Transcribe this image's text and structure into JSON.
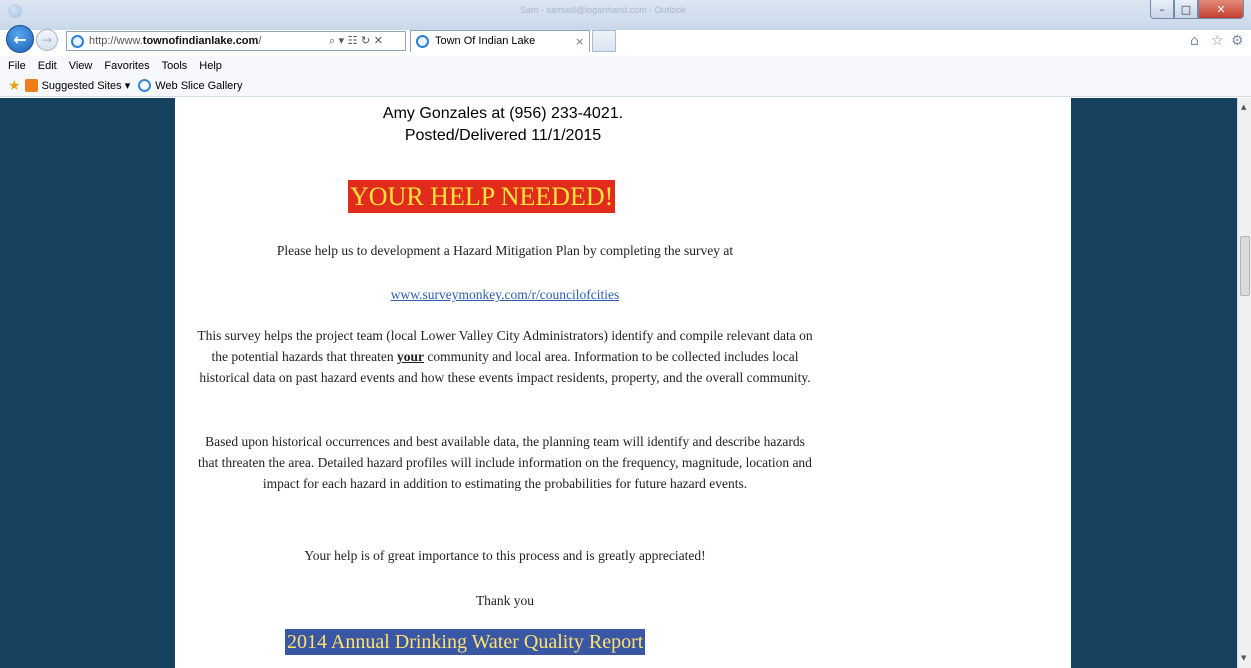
{
  "browser": {
    "window_title": "Sam - samwill@loganhand.com - Outlook",
    "address_prefix": "http://www.",
    "address_domain": "townofindianlake.com",
    "address_suffix": "/",
    "address_controls": "⌕ ▾ ☷ ↻ ✕",
    "tab_title": "Town Of Indian Lake",
    "tab_close": "×",
    "menu": [
      "File",
      "Edit",
      "View",
      "Favorites",
      "Tools",
      "Help"
    ],
    "favorites": {
      "suggested_sites": "Suggested Sites ▾",
      "web_slice_gallery": "Web Slice Gallery"
    },
    "icons": [
      "back-arrow",
      "forward-arrow",
      "ie-logo",
      "home",
      "star",
      "gear"
    ]
  },
  "page": {
    "contact_line": "Amy Gonzales at (956) 233-4021.",
    "posted_line": "Posted/Delivered 11/1/2015",
    "help_banner": "YOUR HELP NEEDED!",
    "intro_line": "Please help us to development a Hazard Mitigation Plan by completing the survey at",
    "survey_link": "www.surveymonkey.com/r/councilofcities",
    "para1_a": "This survey helps the project team (local Lower Valley City Administrators)  identify  and compile relevant data on the potential hazards that threaten ",
    "para1_emph": "your",
    "para1_b": " community and local area.  Information to be collected includes local historical data on past hazard events and how these events impact residents, property, and the overall community.",
    "para2": "Based upon historical occurrences and best available data, the planning team will identify and describe hazards that threaten the area.  Detailed hazard profiles will include information on the frequency, magnitude, location and impact for each hazard in addition to estimating the probabilities for future hazard events.",
    "importance_line": "Your help is of great importance to this process and is greatly appreciated!",
    "thanks_line": "Thank you",
    "report_banner": "2014 Annual Drinking Water Quality Report"
  },
  "colors": {
    "side_background": "#17425f",
    "help_banner_bg": "#e12b1c",
    "help_banner_text": "#ffe53b",
    "report_banner_bg": "#3a57a6",
    "report_banner_text": "#ffe36b",
    "link": "#2a5db0"
  }
}
